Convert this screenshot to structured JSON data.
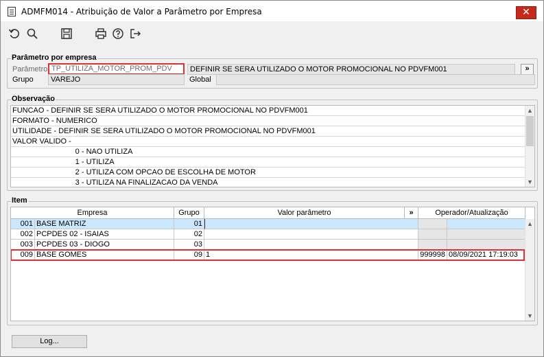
{
  "window": {
    "title": "ADMFM014 - Atribuição de Valor a Parâmetro por Empresa",
    "close_label": "✕"
  },
  "toolbar": {
    "icons": [
      "undo-icon",
      "search-icon",
      "save-icon",
      "print-icon",
      "help-icon",
      "exit-icon"
    ]
  },
  "param_section": {
    "title": "Parâmetro por empresa",
    "parametro_label": "Parâmetro",
    "parametro_value": "TP_UTILIZA_MOTOR_PROM_PDV",
    "parametro_desc": "DEFINIR SE SERA UTILIZADO O MOTOR PROMOCIONAL NO PDVFM001",
    "expand_label": "»",
    "grupo_label": "Grupo",
    "grupo_value": "VAREJO",
    "global_label": "Global",
    "global_value": ""
  },
  "observacao": {
    "title": "Observação",
    "lines": [
      "FUNCAO - DEFINIR SE SERA UTILIZADO O MOTOR PROMOCIONAL NO PDVFM001",
      "FORMATO - NUMERICO",
      "UTILIDADE - DEFINIR SE SERA UTILIZADO O MOTOR PROMOCIONAL NO PDVFM001",
      "VALOR VALIDO -",
      "                              0 - NAO UTILIZA",
      "                              1 - UTILIZA",
      "                              2 - UTILIZA COM OPCAO DE ESCOLHA DE MOTOR",
      "                              3 - UTILIZA NA FINALIZACAO DA VENDA"
    ]
  },
  "item": {
    "title": "Item",
    "columns": {
      "empresa": "Empresa",
      "grupo": "Grupo",
      "valor": "Valor parâmetro",
      "expand": "»",
      "operador": "Operador/Atualização"
    },
    "rows": [
      {
        "code": "001",
        "name": "BASE MATRIZ",
        "grupo": "01",
        "valor": "",
        "operador": "",
        "atualizacao": ""
      },
      {
        "code": "002",
        "name": "PCPDES 02 - ISAIAS",
        "grupo": "02",
        "valor": "",
        "operador": "",
        "atualizacao": ""
      },
      {
        "code": "003",
        "name": "PCPDES 03 - DIOGO",
        "grupo": "03",
        "valor": "",
        "operador": "",
        "atualizacao": ""
      },
      {
        "code": "009",
        "name": "BASE GOMES",
        "grupo": "09",
        "valor": "1",
        "operador": "999998",
        "atualizacao": "08/09/2021 17:19:03"
      }
    ]
  },
  "footer": {
    "log_label": "Log..."
  },
  "colors": {
    "highlight_red": "#e03030",
    "selected_row": "#cce8ff",
    "close_button": "#c42b1c"
  }
}
